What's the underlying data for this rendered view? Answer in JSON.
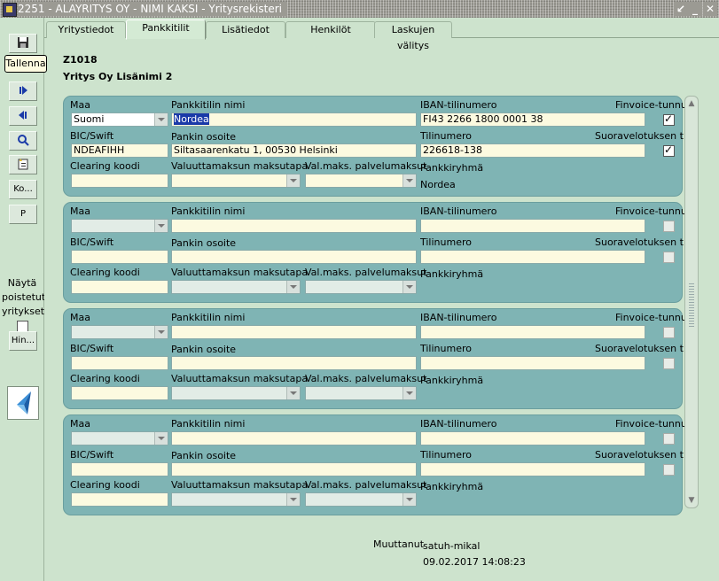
{
  "window": {
    "title": "2251 - ALAYRITYS OY - NIMI KAKSI - Yritysrekisteri",
    "controls": [
      "↙",
      "_",
      "✕"
    ]
  },
  "toolbar": {
    "save_tooltip": "Tallenna",
    "ko_label": "Ko...",
    "p_label": "P",
    "hin_label": "Hin...",
    "show_deleted_label": "Näytä poistetut yritykset"
  },
  "tabs": [
    {
      "label": "Yritystiedot"
    },
    {
      "label": "Pankkitilit"
    },
    {
      "label": "Lisätiedot"
    },
    {
      "label": "Henkilöt"
    },
    {
      "label": "Laskujen välitys"
    }
  ],
  "header": {
    "code": "Z1018",
    "company_name": "Yritys Oy Lisänimi 2"
  },
  "labels": {
    "maa": "Maa",
    "pankkitilin_nimi": "Pankkitilin nimi",
    "iban": "IBAN-tilinumero",
    "finvoice": "Finvoice-tunnus",
    "bic": "BIC/Swift",
    "pankin_osoite": "Pankin osoite",
    "tilinumero": "Tilinumero",
    "suoravelotus": "Suoravelotuksen tili",
    "clearing": "Clearing koodi",
    "valuuttamaksu": "Valuuttamaksun maksutapa",
    "palvelumaksut": "Val.maks. palvelumaksut",
    "pankkiryhma": "Pankkiryhmä"
  },
  "accounts": [
    {
      "maa": "Suomi",
      "pankkitilin_nimi": "Nordea",
      "iban": "FI43 2266 1800 0001 38",
      "finvoice": true,
      "bic": "NDEAFIHH",
      "pankin_osoite": "Siltasaarenkatu 1, 00530 Helsinki",
      "tilinumero": "226618-138",
      "suoravelotus": true,
      "clearing": "",
      "valuuttamaksu": "",
      "palvelumaksut": "",
      "pankkiryhma": "Nordea"
    },
    {
      "maa": "",
      "pankkitilin_nimi": "",
      "iban": "",
      "finvoice": false,
      "bic": "",
      "pankin_osoite": "",
      "tilinumero": "",
      "suoravelotus": false,
      "clearing": "",
      "valuuttamaksu": "",
      "palvelumaksut": "",
      "pankkiryhma": ""
    },
    {
      "maa": "",
      "pankkitilin_nimi": "",
      "iban": "",
      "finvoice": false,
      "bic": "",
      "pankin_osoite": "",
      "tilinumero": "",
      "suoravelotus": false,
      "clearing": "",
      "valuuttamaksu": "",
      "palvelumaksut": "",
      "pankkiryhma": ""
    },
    {
      "maa": "",
      "pankkitilin_nimi": "",
      "iban": "",
      "finvoice": false,
      "bic": "",
      "pankin_osoite": "",
      "tilinumero": "",
      "suoravelotus": false,
      "clearing": "",
      "valuuttamaksu": "",
      "palvelumaksut": "",
      "pankkiryhma": ""
    }
  ],
  "footer": {
    "muuttanut_label": "Muuttanut",
    "user": "satuh-mikal",
    "date": "09.02.2017 14:08:23"
  }
}
